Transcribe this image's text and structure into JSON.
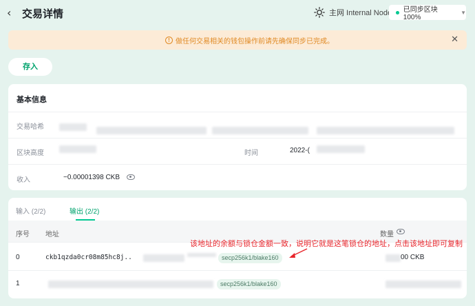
{
  "header": {
    "back_icon": "chevron-left-icon",
    "title": "交易详情",
    "network_icon": "sun-icon",
    "network_label": "主网 Internal Node",
    "sync_status": "已同步区块 100%",
    "sync_color": "#00c891"
  },
  "alert": {
    "message": "做任何交易相关的钱包操作前请先确保同步已完成。",
    "warning_icon_glyph": "!",
    "close_glyph": "✕",
    "color": "#e08a24"
  },
  "actions": {
    "deposit_label": "存入"
  },
  "basic_info": {
    "title": "基本信息",
    "hash_label": "交易哈希",
    "height_label": "区块高度",
    "time_label": "时间",
    "time_value_prefix": "2022-(",
    "income_label": "收入",
    "income_value": "−0.00001398 CKB"
  },
  "tabs": {
    "inputs": "输入 (2/2)",
    "outputs": "输出 (2/2)"
  },
  "table": {
    "columns": {
      "index": "序号",
      "address": "地址",
      "amount": "数量"
    },
    "rows": [
      {
        "index": "0",
        "address": "ckb1qzda0cr08m85hc8j..",
        "lock_type": "secp256k1/blake160",
        "amount_suffix": "00 CKB"
      },
      {
        "index": "1",
        "address": "",
        "lock_type": "secp256k1/blake160",
        "amount_suffix": ""
      }
    ]
  },
  "annotation": {
    "text": "该地址的余额与锁仓金额一致，说明它就是这笔锁仓的地址，点击该地址即可复制",
    "color": "#e8262c"
  }
}
